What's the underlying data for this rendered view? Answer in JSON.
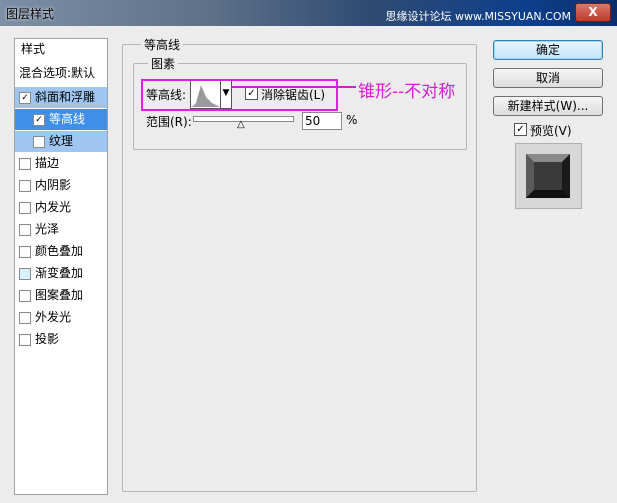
{
  "window": {
    "title": "图层样式",
    "watermark": "思缘设计论坛 www.MISSYUAN.COM",
    "close_label": "X"
  },
  "sidebar": {
    "items": [
      {
        "label": "样式"
      },
      {
        "label": "混合选项:默认"
      },
      {
        "label": "斜面和浮雕",
        "checked": true
      },
      {
        "label": "等高线",
        "checked": true
      },
      {
        "label": "纹理",
        "checked": false
      },
      {
        "label": "描边",
        "checked": false
      },
      {
        "label": "内阴影",
        "checked": false
      },
      {
        "label": "内发光",
        "checked": false
      },
      {
        "label": "光泽",
        "checked": false
      },
      {
        "label": "颜色叠加",
        "checked": false
      },
      {
        "label": "渐变叠加",
        "checked": false
      },
      {
        "label": "图案叠加",
        "checked": false
      },
      {
        "label": "外发光",
        "checked": false
      },
      {
        "label": "投影",
        "checked": false
      }
    ]
  },
  "contour_panel": {
    "group_title": "等高线",
    "subgroup_title": "图素",
    "contour_label": "等高线:",
    "antialias_label": "消除锯齿(L)",
    "antialias_checked": true,
    "range_label": "范围(R):",
    "range_value": "50",
    "range_unit": "%"
  },
  "buttons": {
    "ok": "确定",
    "cancel": "取消",
    "new_style": "新建样式(W)...",
    "preview_label": "预览(V)",
    "preview_checked": true
  },
  "annotation": {
    "text": "锥形--不对称"
  },
  "colors": {
    "highlight": "#3f8fe8",
    "annotation": "#d020d0"
  }
}
